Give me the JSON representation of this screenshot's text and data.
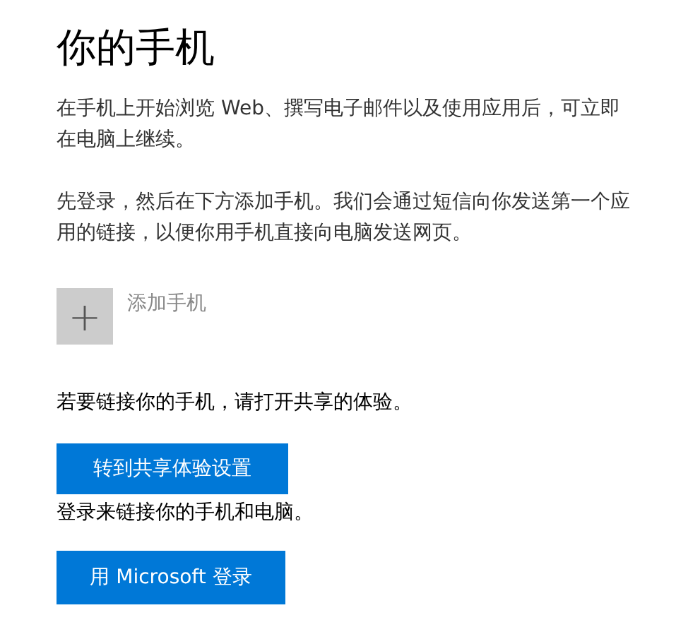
{
  "title": "你的手机",
  "paragraphs": [
    "在手机上开始浏览 Web、撰写电子邮件以及使用应用后，可立即在电脑上继续。",
    "先登录，然后在下方添加手机。我们会通过短信向你发送第一个应用的链接，以便你用手机直接向电脑发送网页。"
  ],
  "add_phone": {
    "icon": "+",
    "label": "添加手机",
    "disabled": true
  },
  "share_notice": "若要链接你的手机，请打开共享的体验。",
  "share_button": "转到共享体验设置",
  "signin_notice": "登录来链接你的手机和电脑。",
  "signin_button": "用 Microsoft 登录"
}
